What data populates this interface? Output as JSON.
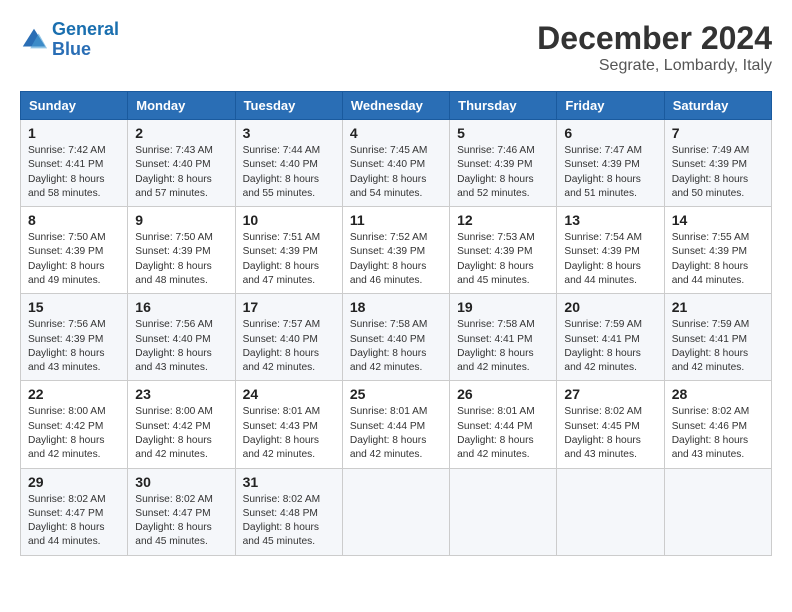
{
  "logo": {
    "line1": "General",
    "line2": "Blue"
  },
  "title": "December 2024",
  "subtitle": "Segrate, Lombardy, Italy",
  "days_of_week": [
    "Sunday",
    "Monday",
    "Tuesday",
    "Wednesday",
    "Thursday",
    "Friday",
    "Saturday"
  ],
  "weeks": [
    [
      {
        "day": 1,
        "sunrise": "7:42 AM",
        "sunset": "4:41 PM",
        "daylight": "8 hours and 58 minutes."
      },
      {
        "day": 2,
        "sunrise": "7:43 AM",
        "sunset": "4:40 PM",
        "daylight": "8 hours and 57 minutes."
      },
      {
        "day": 3,
        "sunrise": "7:44 AM",
        "sunset": "4:40 PM",
        "daylight": "8 hours and 55 minutes."
      },
      {
        "day": 4,
        "sunrise": "7:45 AM",
        "sunset": "4:40 PM",
        "daylight": "8 hours and 54 minutes."
      },
      {
        "day": 5,
        "sunrise": "7:46 AM",
        "sunset": "4:39 PM",
        "daylight": "8 hours and 52 minutes."
      },
      {
        "day": 6,
        "sunrise": "7:47 AM",
        "sunset": "4:39 PM",
        "daylight": "8 hours and 51 minutes."
      },
      {
        "day": 7,
        "sunrise": "7:49 AM",
        "sunset": "4:39 PM",
        "daylight": "8 hours and 50 minutes."
      }
    ],
    [
      {
        "day": 8,
        "sunrise": "7:50 AM",
        "sunset": "4:39 PM",
        "daylight": "8 hours and 49 minutes."
      },
      {
        "day": 9,
        "sunrise": "7:50 AM",
        "sunset": "4:39 PM",
        "daylight": "8 hours and 48 minutes."
      },
      {
        "day": 10,
        "sunrise": "7:51 AM",
        "sunset": "4:39 PM",
        "daylight": "8 hours and 47 minutes."
      },
      {
        "day": 11,
        "sunrise": "7:52 AM",
        "sunset": "4:39 PM",
        "daylight": "8 hours and 46 minutes."
      },
      {
        "day": 12,
        "sunrise": "7:53 AM",
        "sunset": "4:39 PM",
        "daylight": "8 hours and 45 minutes."
      },
      {
        "day": 13,
        "sunrise": "7:54 AM",
        "sunset": "4:39 PM",
        "daylight": "8 hours and 44 minutes."
      },
      {
        "day": 14,
        "sunrise": "7:55 AM",
        "sunset": "4:39 PM",
        "daylight": "8 hours and 44 minutes."
      }
    ],
    [
      {
        "day": 15,
        "sunrise": "7:56 AM",
        "sunset": "4:39 PM",
        "daylight": "8 hours and 43 minutes."
      },
      {
        "day": 16,
        "sunrise": "7:56 AM",
        "sunset": "4:40 PM",
        "daylight": "8 hours and 43 minutes."
      },
      {
        "day": 17,
        "sunrise": "7:57 AM",
        "sunset": "4:40 PM",
        "daylight": "8 hours and 42 minutes."
      },
      {
        "day": 18,
        "sunrise": "7:58 AM",
        "sunset": "4:40 PM",
        "daylight": "8 hours and 42 minutes."
      },
      {
        "day": 19,
        "sunrise": "7:58 AM",
        "sunset": "4:41 PM",
        "daylight": "8 hours and 42 minutes."
      },
      {
        "day": 20,
        "sunrise": "7:59 AM",
        "sunset": "4:41 PM",
        "daylight": "8 hours and 42 minutes."
      },
      {
        "day": 21,
        "sunrise": "7:59 AM",
        "sunset": "4:41 PM",
        "daylight": "8 hours and 42 minutes."
      }
    ],
    [
      {
        "day": 22,
        "sunrise": "8:00 AM",
        "sunset": "4:42 PM",
        "daylight": "8 hours and 42 minutes."
      },
      {
        "day": 23,
        "sunrise": "8:00 AM",
        "sunset": "4:42 PM",
        "daylight": "8 hours and 42 minutes."
      },
      {
        "day": 24,
        "sunrise": "8:01 AM",
        "sunset": "4:43 PM",
        "daylight": "8 hours and 42 minutes."
      },
      {
        "day": 25,
        "sunrise": "8:01 AM",
        "sunset": "4:44 PM",
        "daylight": "8 hours and 42 minutes."
      },
      {
        "day": 26,
        "sunrise": "8:01 AM",
        "sunset": "4:44 PM",
        "daylight": "8 hours and 42 minutes."
      },
      {
        "day": 27,
        "sunrise": "8:02 AM",
        "sunset": "4:45 PM",
        "daylight": "8 hours and 43 minutes."
      },
      {
        "day": 28,
        "sunrise": "8:02 AM",
        "sunset": "4:46 PM",
        "daylight": "8 hours and 43 minutes."
      }
    ],
    [
      {
        "day": 29,
        "sunrise": "8:02 AM",
        "sunset": "4:47 PM",
        "daylight": "8 hours and 44 minutes."
      },
      {
        "day": 30,
        "sunrise": "8:02 AM",
        "sunset": "4:47 PM",
        "daylight": "8 hours and 45 minutes."
      },
      {
        "day": 31,
        "sunrise": "8:02 AM",
        "sunset": "4:48 PM",
        "daylight": "8 hours and 45 minutes."
      },
      null,
      null,
      null,
      null
    ]
  ]
}
